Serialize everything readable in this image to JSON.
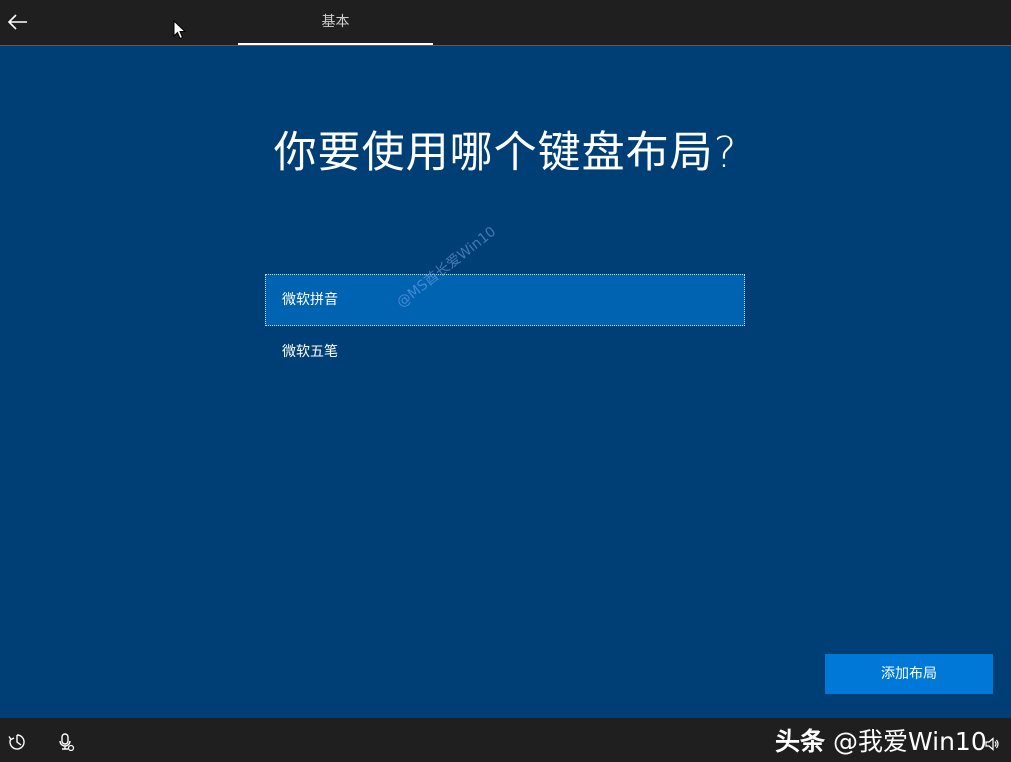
{
  "header": {
    "tab_label": "基本"
  },
  "main": {
    "title": "你要使用哪个键盘布局?",
    "layouts": [
      {
        "label": "微软拼音",
        "selected": true
      },
      {
        "label": "微软五笔",
        "selected": false
      }
    ],
    "watermark": "@MS酋长爱Win10",
    "add_layout_label": "添加布局"
  },
  "footer": {
    "icons": [
      "accessibility-icon",
      "microphone-icon",
      "volume-icon"
    ],
    "source_brand": "头条",
    "source_handle": "@我爱Win10"
  },
  "colors": {
    "background": "#003f75",
    "selected_item": "#0063b1",
    "button": "#0078d7",
    "bars": "#1f1f1f"
  }
}
